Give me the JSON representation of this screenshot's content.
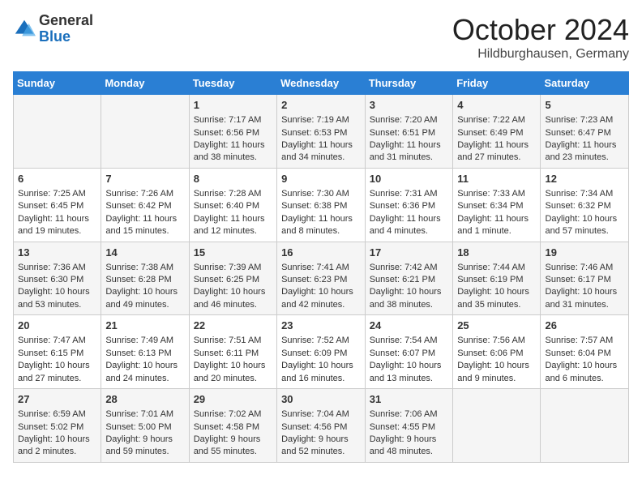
{
  "header": {
    "logo_general": "General",
    "logo_blue": "Blue",
    "month": "October 2024",
    "location": "Hildburghausen, Germany"
  },
  "weekdays": [
    "Sunday",
    "Monday",
    "Tuesday",
    "Wednesday",
    "Thursday",
    "Friday",
    "Saturday"
  ],
  "weeks": [
    [
      {
        "day": "",
        "content": ""
      },
      {
        "day": "",
        "content": ""
      },
      {
        "day": "1",
        "content": "Sunrise: 7:17 AM\nSunset: 6:56 PM\nDaylight: 11 hours and 38 minutes."
      },
      {
        "day": "2",
        "content": "Sunrise: 7:19 AM\nSunset: 6:53 PM\nDaylight: 11 hours and 34 minutes."
      },
      {
        "day": "3",
        "content": "Sunrise: 7:20 AM\nSunset: 6:51 PM\nDaylight: 11 hours and 31 minutes."
      },
      {
        "day": "4",
        "content": "Sunrise: 7:22 AM\nSunset: 6:49 PM\nDaylight: 11 hours and 27 minutes."
      },
      {
        "day": "5",
        "content": "Sunrise: 7:23 AM\nSunset: 6:47 PM\nDaylight: 11 hours and 23 minutes."
      }
    ],
    [
      {
        "day": "6",
        "content": "Sunrise: 7:25 AM\nSunset: 6:45 PM\nDaylight: 11 hours and 19 minutes."
      },
      {
        "day": "7",
        "content": "Sunrise: 7:26 AM\nSunset: 6:42 PM\nDaylight: 11 hours and 15 minutes."
      },
      {
        "day": "8",
        "content": "Sunrise: 7:28 AM\nSunset: 6:40 PM\nDaylight: 11 hours and 12 minutes."
      },
      {
        "day": "9",
        "content": "Sunrise: 7:30 AM\nSunset: 6:38 PM\nDaylight: 11 hours and 8 minutes."
      },
      {
        "day": "10",
        "content": "Sunrise: 7:31 AM\nSunset: 6:36 PM\nDaylight: 11 hours and 4 minutes."
      },
      {
        "day": "11",
        "content": "Sunrise: 7:33 AM\nSunset: 6:34 PM\nDaylight: 11 hours and 1 minute."
      },
      {
        "day": "12",
        "content": "Sunrise: 7:34 AM\nSunset: 6:32 PM\nDaylight: 10 hours and 57 minutes."
      }
    ],
    [
      {
        "day": "13",
        "content": "Sunrise: 7:36 AM\nSunset: 6:30 PM\nDaylight: 10 hours and 53 minutes."
      },
      {
        "day": "14",
        "content": "Sunrise: 7:38 AM\nSunset: 6:28 PM\nDaylight: 10 hours and 49 minutes."
      },
      {
        "day": "15",
        "content": "Sunrise: 7:39 AM\nSunset: 6:25 PM\nDaylight: 10 hours and 46 minutes."
      },
      {
        "day": "16",
        "content": "Sunrise: 7:41 AM\nSunset: 6:23 PM\nDaylight: 10 hours and 42 minutes."
      },
      {
        "day": "17",
        "content": "Sunrise: 7:42 AM\nSunset: 6:21 PM\nDaylight: 10 hours and 38 minutes."
      },
      {
        "day": "18",
        "content": "Sunrise: 7:44 AM\nSunset: 6:19 PM\nDaylight: 10 hours and 35 minutes."
      },
      {
        "day": "19",
        "content": "Sunrise: 7:46 AM\nSunset: 6:17 PM\nDaylight: 10 hours and 31 minutes."
      }
    ],
    [
      {
        "day": "20",
        "content": "Sunrise: 7:47 AM\nSunset: 6:15 PM\nDaylight: 10 hours and 27 minutes."
      },
      {
        "day": "21",
        "content": "Sunrise: 7:49 AM\nSunset: 6:13 PM\nDaylight: 10 hours and 24 minutes."
      },
      {
        "day": "22",
        "content": "Sunrise: 7:51 AM\nSunset: 6:11 PM\nDaylight: 10 hours and 20 minutes."
      },
      {
        "day": "23",
        "content": "Sunrise: 7:52 AM\nSunset: 6:09 PM\nDaylight: 10 hours and 16 minutes."
      },
      {
        "day": "24",
        "content": "Sunrise: 7:54 AM\nSunset: 6:07 PM\nDaylight: 10 hours and 13 minutes."
      },
      {
        "day": "25",
        "content": "Sunrise: 7:56 AM\nSunset: 6:06 PM\nDaylight: 10 hours and 9 minutes."
      },
      {
        "day": "26",
        "content": "Sunrise: 7:57 AM\nSunset: 6:04 PM\nDaylight: 10 hours and 6 minutes."
      }
    ],
    [
      {
        "day": "27",
        "content": "Sunrise: 6:59 AM\nSunset: 5:02 PM\nDaylight: 10 hours and 2 minutes."
      },
      {
        "day": "28",
        "content": "Sunrise: 7:01 AM\nSunset: 5:00 PM\nDaylight: 9 hours and 59 minutes."
      },
      {
        "day": "29",
        "content": "Sunrise: 7:02 AM\nSunset: 4:58 PM\nDaylight: 9 hours and 55 minutes."
      },
      {
        "day": "30",
        "content": "Sunrise: 7:04 AM\nSunset: 4:56 PM\nDaylight: 9 hours and 52 minutes."
      },
      {
        "day": "31",
        "content": "Sunrise: 7:06 AM\nSunset: 4:55 PM\nDaylight: 9 hours and 48 minutes."
      },
      {
        "day": "",
        "content": ""
      },
      {
        "day": "",
        "content": ""
      }
    ]
  ]
}
